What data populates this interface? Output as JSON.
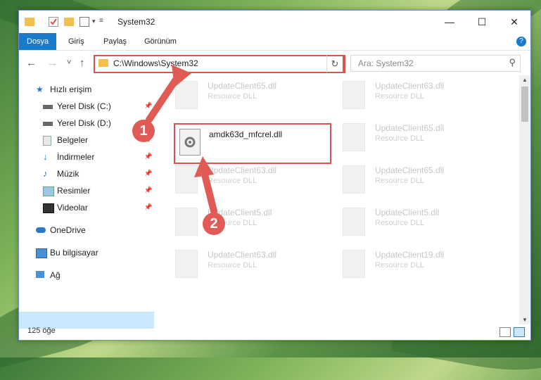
{
  "window": {
    "title": "System32",
    "controls": {
      "minimize": "—",
      "maximize": "☐",
      "close": "✕"
    }
  },
  "ribbon": {
    "tabs": [
      "Dosya",
      "Giriş",
      "Paylaş",
      "Görünüm"
    ],
    "help": "?"
  },
  "navigation": {
    "back": "←",
    "forward": "→",
    "recent": "˅",
    "up": "↑",
    "address": "C:\\Windows\\System32",
    "dropdown": "˅",
    "refresh": "↻",
    "search_placeholder": "Ara: System32",
    "search_icon": "⚲"
  },
  "sidebar": {
    "items": [
      {
        "label": "Hızlı erişim",
        "icon": "star-icon"
      },
      {
        "label": "Yerel Disk (C:)",
        "icon": "drive-icon",
        "pinned": true
      },
      {
        "label": "Yerel Disk (D:)",
        "icon": "drive-icon",
        "pinned": false
      },
      {
        "label": "Belgeler",
        "icon": "documents-icon",
        "pinned": true
      },
      {
        "label": "İndirmeler",
        "icon": "download-icon",
        "pinned": true
      },
      {
        "label": "Müzik",
        "icon": "music-icon",
        "pinned": true
      },
      {
        "label": "Resimler",
        "icon": "pictures-icon",
        "pinned": true
      },
      {
        "label": "Videolar",
        "icon": "videos-icon",
        "pinned": true
      },
      {
        "label": "OneDrive",
        "icon": "cloud-icon"
      },
      {
        "label": "Bu bilgisayar",
        "icon": "computer-icon",
        "selected": true
      },
      {
        "label": "Ağ",
        "icon": "network-icon"
      }
    ]
  },
  "files": {
    "featured": {
      "name": "amdk63d_mfcrel.dll"
    },
    "ghosts": [
      {
        "name": "UpdateClient65.dll",
        "type": "Resource DLL"
      },
      {
        "name": "UpdateClient63.dll",
        "type": "Resource DLL"
      },
      {
        "name": "UpdateClient65.dll",
        "type": "Resource DLL"
      },
      {
        "name": "UpdateClient63.dll",
        "type": "Resource DLL"
      },
      {
        "name": "UpdateClient65.dll",
        "type": "Resource DLL"
      },
      {
        "name": "UpdateClient5.dll",
        "type": "Resource DLL"
      },
      {
        "name": "UpdateClient5.dll",
        "type": "Resource DLL"
      },
      {
        "name": "UpdateClient63.dll",
        "type": "Resource DLL"
      },
      {
        "name": "UpdateClient19.dll",
        "type": "Resource DLL"
      }
    ]
  },
  "annotations": {
    "step1": "1",
    "step2": "2",
    "color": "#e15b56"
  },
  "status": {
    "count": "125 öğe"
  }
}
